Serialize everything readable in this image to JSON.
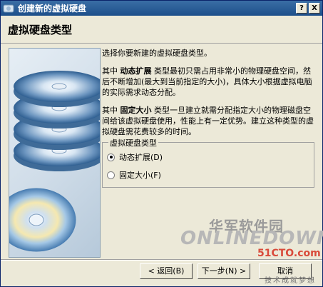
{
  "window": {
    "title": "创建新的虚拟硬盘",
    "help_label": "?",
    "close_label": "X"
  },
  "header": {
    "title": "虚拟硬盘类型"
  },
  "content": {
    "intro": "选择你要新建的虚拟硬盘类型。",
    "dynamic": {
      "prefix": "其中",
      "keyword": "动态扩展",
      "desc": "类型最初只需占用非常小的物理硬盘空间，然后不断增加(最大到当前指定的大小)，具体大小根据虚拟电脑的实际需求动态分配。"
    },
    "fixed": {
      "prefix": "其中",
      "keyword": "固定大小",
      "desc": "类型一旦建立就需分配指定大小的物理磁盘空间给该虚拟硬盘使用，性能上有一定优势。建立这种类型的虚拟硬盘需花费较多的时间。"
    }
  },
  "group": {
    "title": "虚拟硬盘类型",
    "options": [
      {
        "label": "动态扩展(D)",
        "selected": true
      },
      {
        "label": "固定大小(F)",
        "selected": false
      }
    ]
  },
  "buttons": {
    "back": "< 返回(B)",
    "next": "下一步(N) >",
    "cancel": "取消"
  },
  "watermark": {
    "line1": "华军软件园",
    "line2": "ONLINEDOWN",
    "line3": "51CTO.com",
    "line4": "技术成就梦想"
  },
  "icons": [
    "app-icon",
    "disk-stack-icon",
    "cd-disc-icon"
  ]
}
